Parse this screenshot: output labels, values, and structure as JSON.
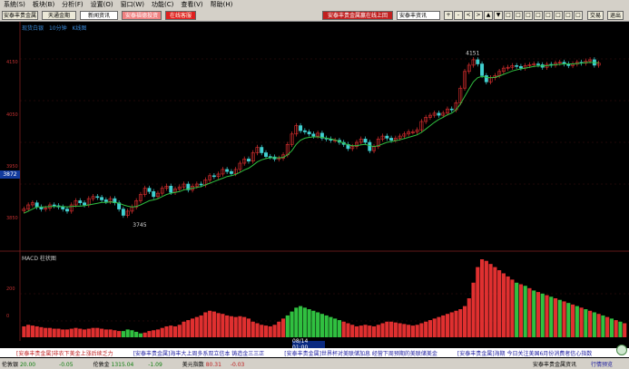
{
  "menu": [
    "系统(S)",
    "板块(B)",
    "分析(F)",
    "设置(O)",
    "窗口(W)",
    "功能(C)",
    "查看(V)",
    "帮助(H)"
  ],
  "toolbar": {
    "left_buttons": [
      "安泰丰贵金属",
      "天通金期",
      "新闻资讯",
      "安泰福德投资",
      "在线客服"
    ],
    "promo": "安泰丰贵金属赢在线上回",
    "select": "安泰丰资讯",
    "icons": [
      "+",
      "-",
      "<",
      ">",
      "▲",
      "▼",
      "□",
      "□",
      "□",
      "□",
      "□",
      "□",
      "□",
      "□"
    ],
    "right_buttons": [
      "交易",
      "退出"
    ]
  },
  "chart": {
    "title_parts": [
      "现货白银",
      "10分钟",
      "K线图"
    ],
    "price_box": "3872",
    "high_label": "4151",
    "low_label": "3745",
    "sub_title": "MACD 柱状图",
    "time_box": "08/14 01:00"
  },
  "chart_data": {
    "type": "candlestick",
    "xlabel": "",
    "ylabel": "",
    "ylim": [
      3700,
      4200
    ],
    "close": [
      3790,
      3800,
      3805,
      3795,
      3790,
      3792,
      3800,
      3798,
      3795,
      3790,
      3785,
      3800,
      3810,
      3805,
      3800,
      3815,
      3820,
      3818,
      3812,
      3808,
      3815,
      3805,
      3790,
      3775,
      3785,
      3795,
      3810,
      3825,
      3840,
      3832,
      3820,
      3828,
      3840,
      3845,
      3830,
      3838,
      3843,
      3850,
      3836,
      3845,
      3850,
      3848,
      3860,
      3870,
      3868,
      3874,
      3885,
      3880,
      3875,
      3885,
      3900,
      3910,
      3905,
      3925,
      3938,
      3925,
      3916,
      3915,
      3910,
      3912,
      3920,
      3945,
      3970,
      3990,
      3978,
      3975,
      3970,
      3965,
      3972,
      3960,
      3958,
      3955,
      3955,
      3950,
      3945,
      3935,
      3940,
      3950,
      3958,
      3950,
      3930,
      3940,
      3958,
      3965,
      3960,
      3955,
      3960,
      3965,
      3970,
      3975,
      3975,
      3980,
      4000,
      4010,
      4015,
      4020,
      4015,
      4020,
      4030,
      4028,
      4045,
      4080,
      4120,
      4135,
      4148,
      4138,
      4110,
      4095,
      4105,
      4110,
      4120,
      4128,
      4130,
      4134,
      4132,
      4128,
      4134,
      4136,
      4138,
      4136,
      4130,
      4137,
      4135,
      4140,
      4142,
      4138,
      4134,
      4138,
      4142,
      4140,
      4145,
      4148,
      4135,
      4140
    ],
    "ma_line": [
      3780,
      3785,
      3790,
      3795,
      3795,
      3795,
      3796,
      3796,
      3796,
      3796,
      3795,
      3796,
      3797,
      3797,
      3798,
      3800,
      3802,
      3804,
      3806,
      3806,
      3807,
      3806,
      3804,
      3800,
      3797,
      3795,
      3796,
      3800,
      3805,
      3810,
      3812,
      3815,
      3820,
      3825,
      3828,
      3830,
      3832,
      3836,
      3838,
      3840,
      3842,
      3844,
      3848,
      3852,
      3856,
      3860,
      3864,
      3868,
      3870,
      3873,
      3878,
      3884,
      3888,
      3895,
      3903,
      3908,
      3911,
      3913,
      3913,
      3913,
      3914,
      3920,
      3930,
      3945,
      3955,
      3960,
      3962,
      3963,
      3963,
      3962,
      3960,
      3958,
      3956,
      3952,
      3948,
      3944,
      3942,
      3942,
      3944,
      3945,
      3942,
      3940,
      3942,
      3946,
      3950,
      3952,
      3954,
      3956,
      3959,
      3962,
      3965,
      3968,
      3974,
      3982,
      3990,
      3998,
      4005,
      4010,
      4016,
      4020,
      4028,
      4042,
      4060,
      4078,
      4095,
      4105,
      4108,
      4106,
      4105,
      4106,
      4109,
      4113,
      4117,
      4121,
      4124,
      4126,
      4128,
      4130,
      4132,
      4133,
      4133,
      4134,
      4135,
      4136,
      4137,
      4138,
      4138,
      4138,
      4139,
      4140,
      4141,
      4142,
      4141,
      4141
    ],
    "macd": [
      0.14,
      0.16,
      0.15,
      0.14,
      0.13,
      0.12,
      0.12,
      0.11,
      0.11,
      0.1,
      0.1,
      0.11,
      0.12,
      0.11,
      0.1,
      0.11,
      0.12,
      0.12,
      0.11,
      0.1,
      0.1,
      0.09,
      0.08,
      -0.08,
      -0.1,
      -0.09,
      -0.07,
      -0.05,
      0.06,
      0.08,
      0.09,
      0.1,
      0.12,
      0.14,
      0.15,
      0.14,
      0.16,
      0.2,
      0.22,
      0.24,
      0.26,
      0.28,
      0.32,
      0.34,
      0.33,
      0.31,
      0.3,
      0.28,
      0.27,
      0.26,
      0.27,
      0.26,
      0.24,
      0.2,
      0.18,
      0.16,
      0.15,
      0.14,
      0.16,
      0.2,
      0.24,
      0.28,
      0.33,
      0.38,
      0.4,
      0.38,
      0.36,
      0.34,
      0.32,
      0.3,
      0.28,
      0.26,
      0.24,
      0.22,
      0.2,
      0.18,
      0.16,
      0.14,
      0.15,
      0.16,
      0.15,
      0.14,
      0.16,
      0.18,
      0.2,
      0.2,
      0.19,
      0.18,
      0.17,
      0.16,
      0.15,
      0.16,
      0.18,
      0.2,
      0.22,
      0.24,
      0.26,
      0.28,
      0.3,
      0.32,
      0.34,
      0.36,
      0.4,
      0.5,
      0.7,
      0.9,
      1.0,
      0.98,
      0.94,
      0.9,
      0.86,
      0.82,
      0.78,
      0.74,
      0.7,
      0.68,
      0.66,
      0.63,
      0.6,
      0.58,
      0.56,
      0.54,
      0.52,
      0.5,
      0.48,
      0.46,
      0.44,
      0.42,
      0.4,
      0.38,
      0.36,
      0.34,
      0.32,
      0.3,
      0.28,
      0.26,
      0.24,
      0.22,
      0.2,
      0.18
    ]
  },
  "y_labels": [
    "4150",
    "4050",
    "3950",
    "3850",
    "200",
    "0"
  ],
  "news": [
    "[安泰丰贵金属]非农下美金上涨后续乏力",
    "[安泰丰贵金属]海丰大上周多系双立信本 铸造金三三正",
    "[安泰丰贵金属]世界杯对美联储加息 经营下周预期的美联储美金",
    "[安泰丰贵金属]海期 今日关注美国6月份消费者信心指数"
  ],
  "status": [
    {
      "label": "伦敦银",
      "value": "20.00",
      "change": "-0.05",
      "cls": "g"
    },
    {
      "label": "伦敦金",
      "value": "1315.04",
      "change": "-1.09",
      "cls": "g"
    },
    {
      "label": "美元指数",
      "value": "80.31",
      "change": "-0.03",
      "cls": "r"
    }
  ],
  "status_right": "安泰丰贵金属资讯",
  "status_right2": "行情预览"
}
